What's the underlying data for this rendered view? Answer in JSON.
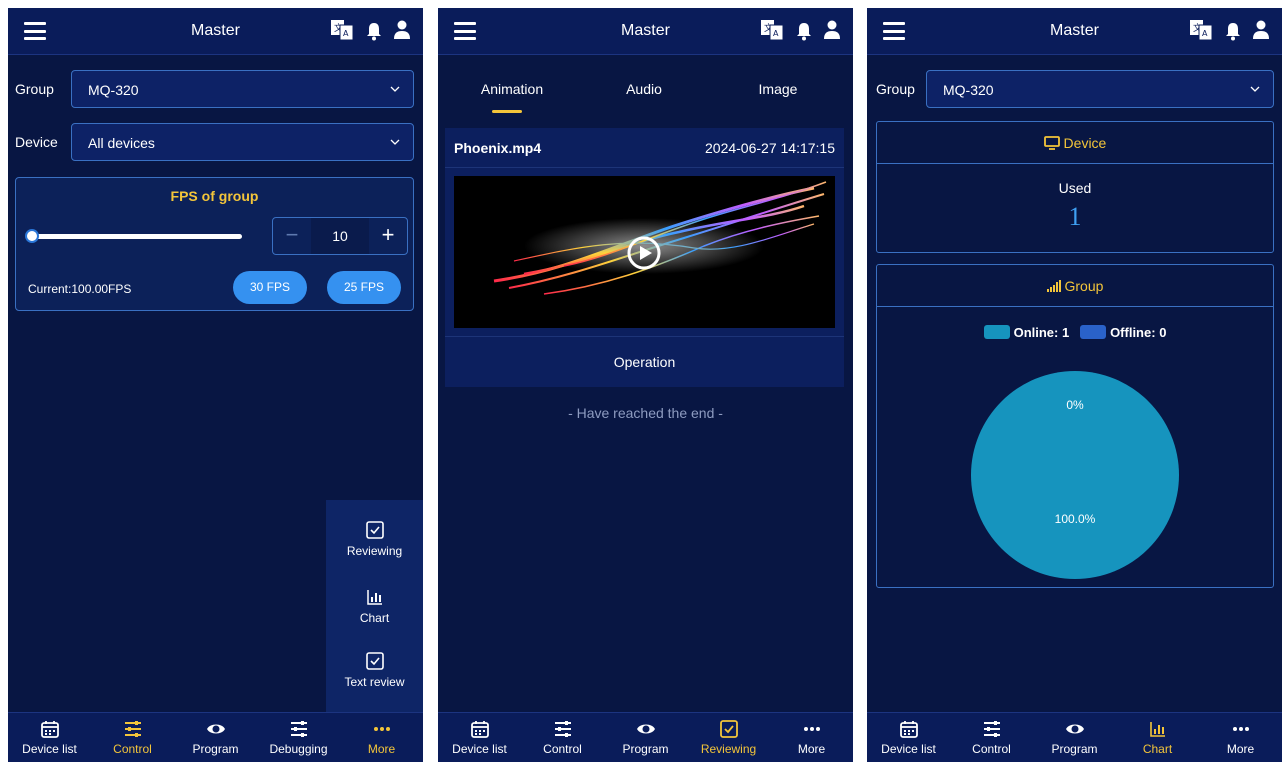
{
  "header": {
    "title": "Master"
  },
  "colors": {
    "background": "#081643",
    "bar": "#0a1c5a",
    "accent": "#f3c53a",
    "button": "#3591f0",
    "online": "#1694be",
    "offline": "#2a62c9"
  },
  "nav": {
    "items": [
      "Device list",
      "Control",
      "Program",
      "Debugging",
      "More"
    ],
    "items_reviewing": [
      "Device list",
      "Control",
      "Program",
      "Reviewing",
      "More"
    ],
    "items_chart": [
      "Device list",
      "Control",
      "Program",
      "Chart",
      "More"
    ],
    "icons": [
      "calendar-icon",
      "sliders-icon",
      "eye-icon",
      "sliders-icon",
      "dots-icon"
    ]
  },
  "control": {
    "group_label": "Group",
    "group_value": "MQ-320",
    "device_label": "Device",
    "device_value": "All devices",
    "fps_title": "FPS of group",
    "slider_fraction": 0.0,
    "stepper_value": "10",
    "stepper_minus": "−",
    "stepper_plus": "+",
    "current_text": "Current:100.00FPS",
    "preset_1": "30 FPS",
    "preset_2": "25 FPS",
    "more_menu": [
      "Reviewing",
      "Chart",
      "Text review"
    ]
  },
  "reviewing": {
    "tabs": [
      "Animation",
      "Audio",
      "Image"
    ],
    "active_tab": "Animation",
    "file_name": "Phoenix.mp4",
    "file_time": "2024-06-27 14:17:15",
    "operation_label": "Operation",
    "end_note": "- Have reached the end -"
  },
  "chart_screen": {
    "group_label": "Group",
    "group_value": "MQ-320",
    "device_card_title": "Device",
    "used_label": "Used",
    "used_value": "1",
    "group_card_title": "Group"
  },
  "chart_data": {
    "type": "pie",
    "categories": [
      "Online",
      "Offline"
    ],
    "values": [
      1,
      0
    ],
    "legend": [
      {
        "name": "Online",
        "value_text": "1"
      },
      {
        "name": "Offline",
        "value_text": "0"
      }
    ],
    "slice_labels": [
      "100.0%",
      "0%"
    ],
    "legend_position": "top-center"
  }
}
